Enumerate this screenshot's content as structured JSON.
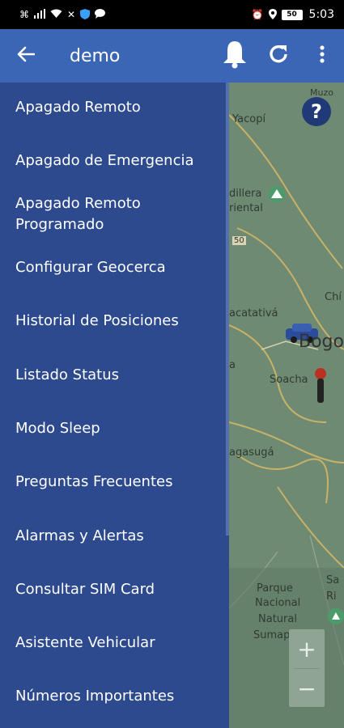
{
  "status_bar": {
    "icons": [
      "debug-icon",
      "signal-icon",
      "wifi-icon",
      "mute-icon",
      "shield-icon",
      "chat-icon"
    ],
    "right_icons": [
      "alarm-icon",
      "location-icon"
    ],
    "battery": "50",
    "time": "5:03"
  },
  "app_bar": {
    "title": "demo",
    "back_icon": "arrow-left-icon",
    "bell_icon": "bell-icon",
    "refresh_icon": "refresh-icon",
    "more_icon": "more-vert-icon",
    "background": "#3b66b5"
  },
  "drawer": {
    "background": "#2d4a8f",
    "items": [
      {
        "label": "Apagado Remoto"
      },
      {
        "label": "Apagado de Emergencia"
      },
      {
        "label": "Apagado Remoto\nProgramado"
      },
      {
        "label": "Configurar Geocerca"
      },
      {
        "label": "Historial de Posiciones"
      },
      {
        "label": "Listado Status"
      },
      {
        "label": "Modo Sleep"
      },
      {
        "label": "Preguntas Frecuentes"
      },
      {
        "label": "Alarmas y Alertas"
      },
      {
        "label": "Consultar SIM Card"
      },
      {
        "label": "Asistente Vehicular"
      },
      {
        "label": "Números Importantes"
      }
    ]
  },
  "map": {
    "labels": {
      "muzo": "Muzo",
      "yacopi": "Yacopí",
      "cordillera": "dillera",
      "oriental": "riental",
      "route": "50",
      "chia": "Chí",
      "facatativa": "acatativá",
      "bogota": "Bogo",
      "soacha": "Soacha",
      "la": "a",
      "fusagasuga": "agasugá",
      "parque": "Parque",
      "nacional": "Nacional",
      "natural": "Natural",
      "sumapaz": "Sumapaz",
      "sa": "Sa",
      "ri": "Ri"
    },
    "help_label": "?",
    "zoom_in": "+",
    "zoom_out": "−"
  }
}
